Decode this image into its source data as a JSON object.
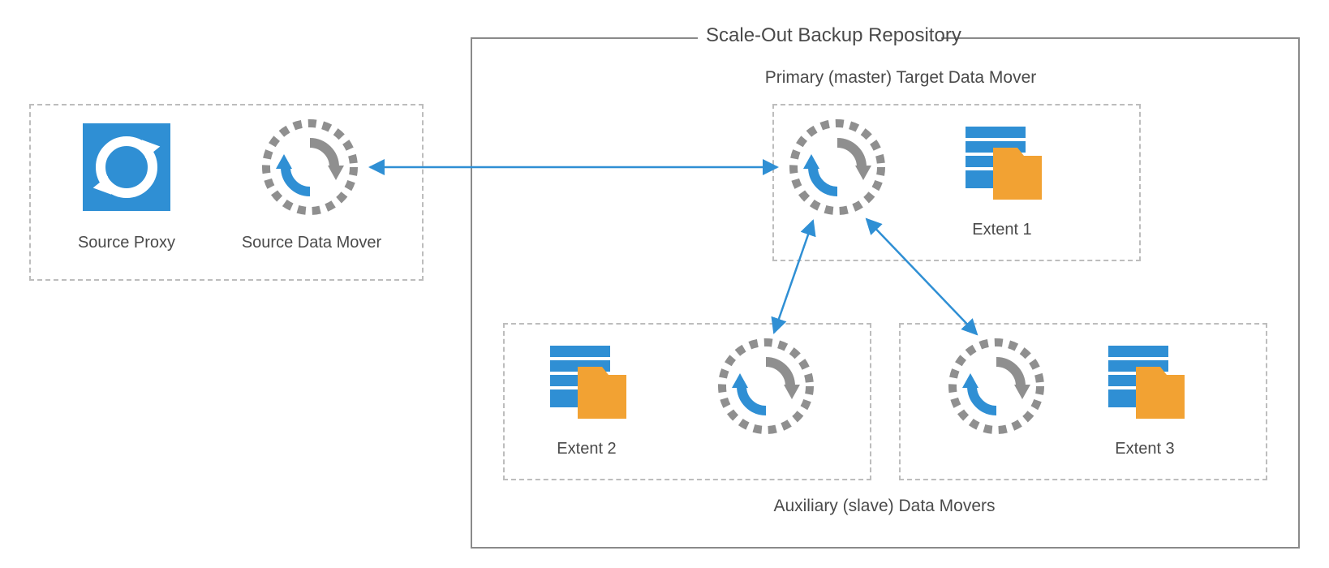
{
  "repository_title": "Scale-Out Backup Repository",
  "source": {
    "proxy_label": "Source Proxy",
    "mover_label": "Source Data Mover"
  },
  "primary_section_label": "Primary (master) Target Data Mover",
  "auxiliary_section_label": "Auxiliary (slave) Data Movers",
  "extents": {
    "e1": "Extent 1",
    "e2": "Extent 2",
    "e3": "Extent 3"
  },
  "colors": {
    "blue": "#2f8fd4",
    "orange": "#f2a233",
    "gray": "#8f8f8f",
    "dashGray": "#bdbdbd"
  }
}
